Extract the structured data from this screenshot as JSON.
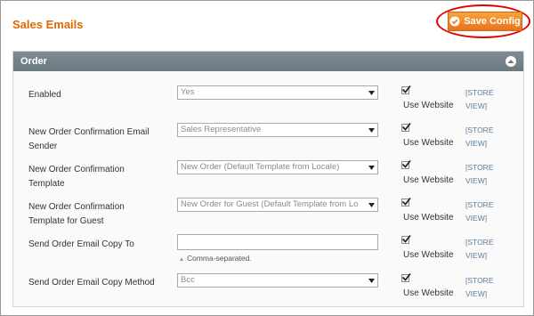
{
  "header": {
    "title": "Sales Emails",
    "save_label": "Save Config"
  },
  "section": {
    "title": "Order"
  },
  "fields": [
    {
      "label": "Enabled",
      "value": "Yes",
      "use_website": "Use Website",
      "scope": "[STORE VIEW]"
    },
    {
      "label": "New Order Confirmation Email Sender",
      "value": "Sales Representative",
      "use_website": "Use Website",
      "scope": "[STORE VIEW]"
    },
    {
      "label": "New Order Confirmation Template",
      "value": "New Order (Default Template from Locale)",
      "use_website": "Use Website",
      "scope": "[STORE VIEW]"
    },
    {
      "label": "New Order Confirmation Template for Guest",
      "value": "New Order for Guest (Default Template from Lo",
      "use_website": "Use Website",
      "scope": "[STORE VIEW]"
    },
    {
      "label": "Send Order Email Copy To",
      "value": "",
      "note": "Comma-separated.",
      "use_website": "Use Website",
      "scope": "[STORE VIEW]"
    },
    {
      "label": "Send Order Email Copy Method",
      "value": "Bcc",
      "use_website": "Use Website",
      "scope": "[STORE VIEW]"
    }
  ],
  "colors": {
    "title": "#e26703",
    "button": "#f0901f",
    "highlight_ring": "#e00000",
    "section_header": "#74828a",
    "scope_link": "#5a7ea0"
  },
  "icons": {
    "save": "check-circle-icon",
    "collapse": "chevron-up-icon",
    "dropdown": "dropdown-arrow-icon",
    "checkbox": "checkmark-icon"
  }
}
